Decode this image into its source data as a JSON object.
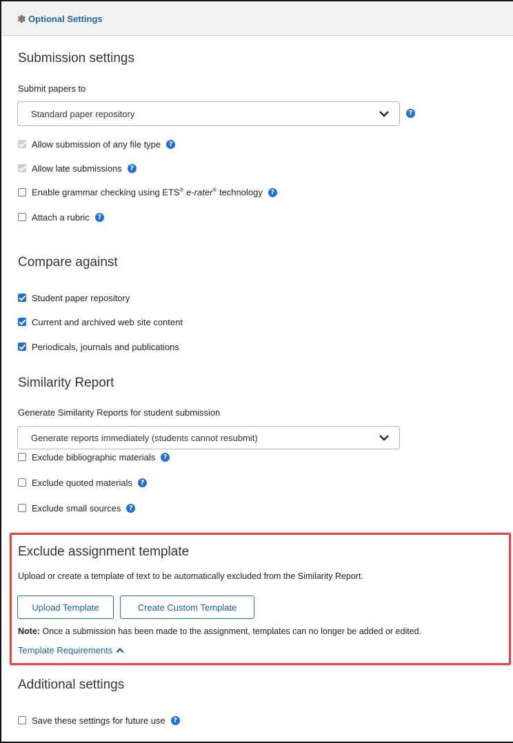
{
  "header": {
    "title": "Optional Settings",
    "icon": "gear-icon"
  },
  "submission": {
    "heading": "Submission settings",
    "submit_label": "Submit papers to",
    "submit_value": "Standard paper repository",
    "options": [
      {
        "label": "Allow submission of any file type",
        "state": "disabled-checked"
      },
      {
        "label": "Allow late submissions",
        "state": "disabled-checked"
      },
      {
        "label_pre": "Enable grammar checking using ETS",
        "label_mid1": " e-rater",
        "label_post": " technology",
        "sup": "®",
        "state": "unchecked"
      },
      {
        "label": "Attach a rubric",
        "state": "unchecked"
      }
    ]
  },
  "compare": {
    "heading": "Compare against",
    "options": [
      {
        "label": "Student paper repository",
        "state": "checked"
      },
      {
        "label": "Current and archived web site content",
        "state": "checked"
      },
      {
        "label": "Periodicals, journals and publications",
        "state": "checked"
      }
    ]
  },
  "similarity": {
    "heading": "Similarity Report",
    "generate_label": "Generate Similarity Reports for student submission",
    "generate_value": "Generate reports immediately (students cannot resubmit)",
    "options": [
      {
        "label": "Exclude bibliographic materials",
        "state": "unchecked"
      },
      {
        "label": "Exclude quoted materials",
        "state": "unchecked"
      },
      {
        "label": "Exclude small sources",
        "state": "unchecked"
      }
    ]
  },
  "template": {
    "heading": "Exclude assignment template",
    "description": "Upload or create a template of text to be automatically excluded from the Similarity Report.",
    "upload_label": "Upload Template",
    "create_label": "Create Custom Template",
    "note_bold": "Note:",
    "note_text": " Once a submission has been made to the assignment, templates can no longer be added or edited.",
    "requirements_link": "Template Requirements"
  },
  "additional": {
    "heading": "Additional settings",
    "save_label": "Save these settings for future use"
  },
  "colors": {
    "accent": "#1f6fd6",
    "highlight_border": "#e0454b",
    "header_bg": "#f1f1f1"
  }
}
